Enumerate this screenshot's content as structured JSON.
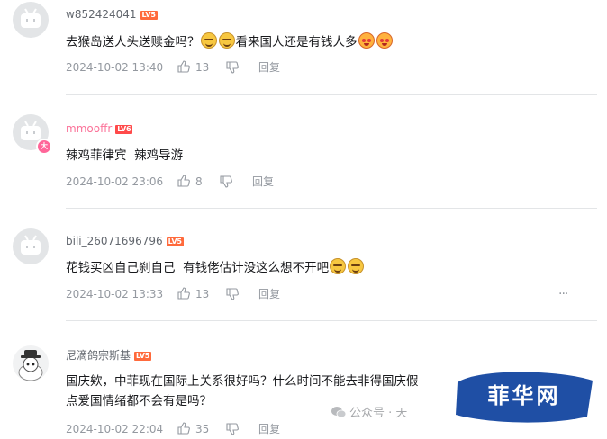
{
  "comments": [
    {
      "username": "w852424041",
      "level": "LV5",
      "text_a": "去猴岛送人头送赎金吗？",
      "text_b": "看来国人还是有钱人多",
      "date": "2024-10-02 13:40",
      "likes": "13",
      "reply": "回复"
    },
    {
      "username": "mmooffr",
      "level": "LV6",
      "vip": "大",
      "text_a": "辣鸡菲律宾  辣鸡导游",
      "date": "2024-10-02 23:06",
      "likes": "8",
      "reply": "回复"
    },
    {
      "username": "bili_26071696796",
      "level": "LV5",
      "text_a": "花钱买凶自己刹自己  有钱佬估计没这么想不开吧",
      "date": "2024-10-02 13:33",
      "likes": "13",
      "reply": "回复",
      "more": "···"
    },
    {
      "username": "尼滴鸽宗斯基",
      "level": "LV5",
      "text_line1": "国庆欸，中菲现在国际上关系很好吗？什么时间不能去非得国庆假",
      "text_line2": "点爱国情绪都不会有是吗？",
      "date": "2024-10-02 22:04",
      "likes": "35",
      "reply": "回复"
    }
  ],
  "watermark": {
    "text": "公众号 · 天",
    "logo_text": "菲华网"
  },
  "colors": {
    "username_default": "#61666d",
    "username_vip": "#fb7299",
    "level_badge": "#ff6a3c",
    "meta_gray": "#9499a0",
    "logo_blue": "#1f4fa5"
  }
}
